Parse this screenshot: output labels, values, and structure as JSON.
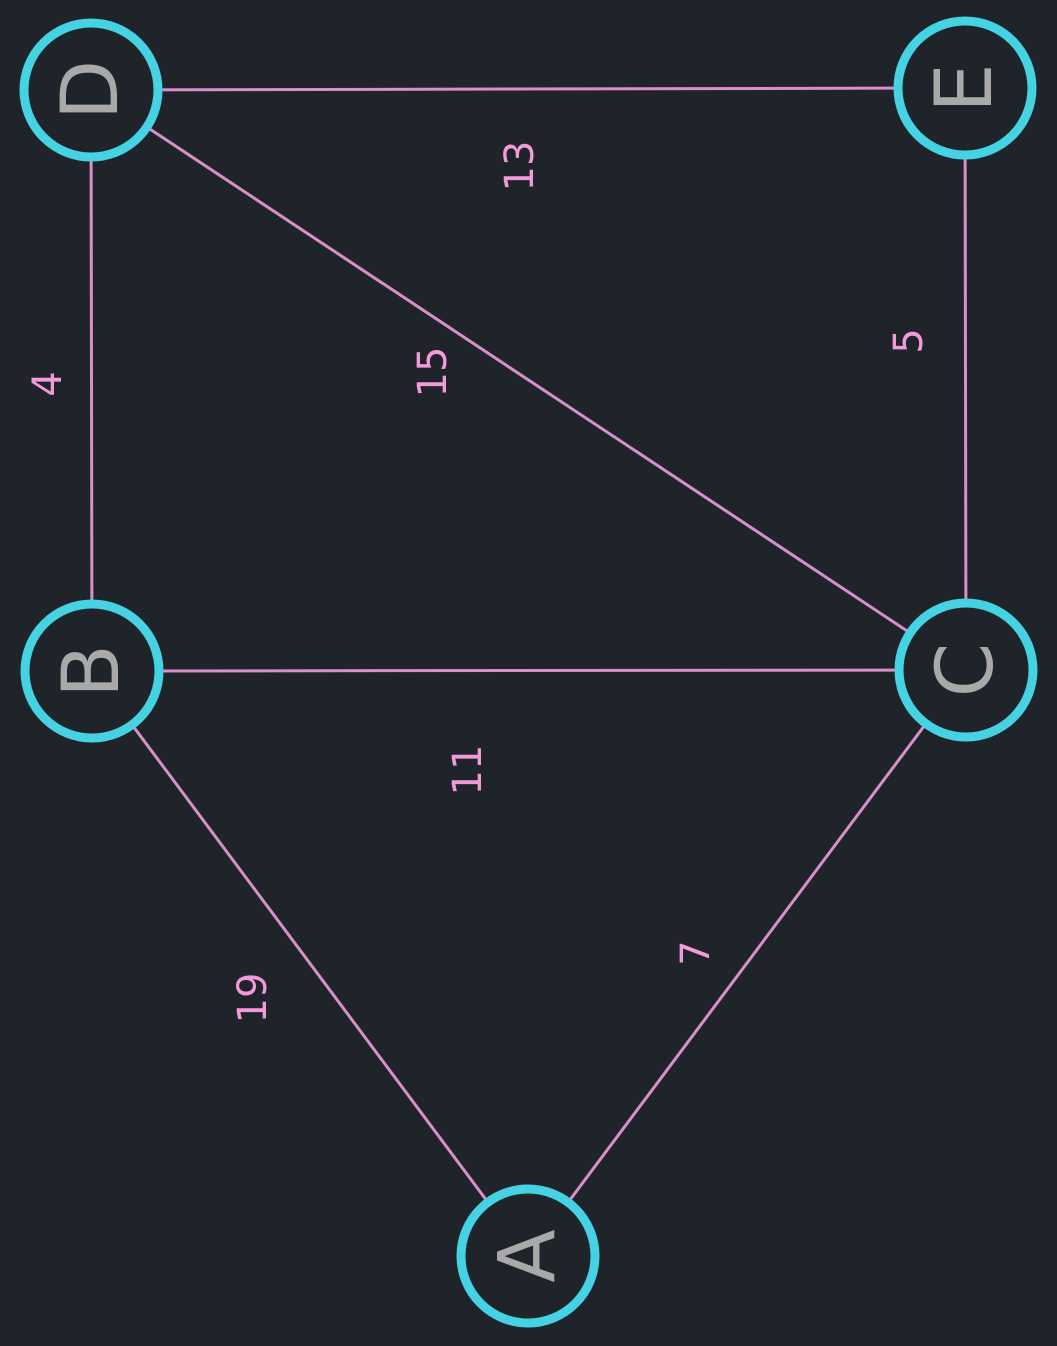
{
  "colors": {
    "background": "#1f242b",
    "edge": "#d98fc8",
    "weight_text": "#f39bd9",
    "node_ring": "#45d3e3",
    "node_text": "#a9a9a9"
  },
  "nodes": [
    {
      "id": "A",
      "label": "A"
    },
    {
      "id": "B",
      "label": "B"
    },
    {
      "id": "C",
      "label": "C"
    },
    {
      "id": "D",
      "label": "D"
    },
    {
      "id": "E",
      "label": "E"
    }
  ],
  "edges": [
    {
      "from": "A",
      "to": "B",
      "weight": "19"
    },
    {
      "from": "A",
      "to": "C",
      "weight": "7"
    },
    {
      "from": "B",
      "to": "C",
      "weight": "11"
    },
    {
      "from": "B",
      "to": "D",
      "weight": "4"
    },
    {
      "from": "C",
      "to": "D",
      "weight": "15"
    },
    {
      "from": "C",
      "to": "E",
      "weight": "5"
    },
    {
      "from": "D",
      "to": "E",
      "weight": "13"
    }
  ]
}
